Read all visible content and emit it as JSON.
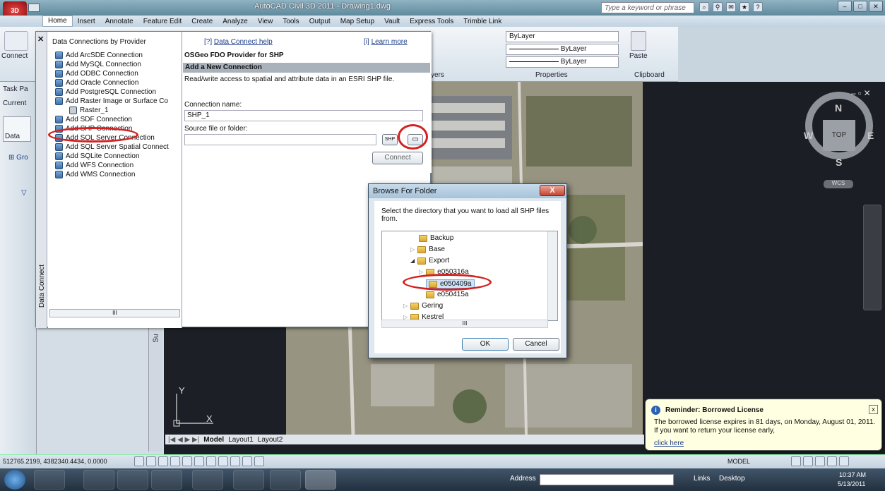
{
  "titlebar": {
    "app_badge": "3D",
    "title": "AutoCAD Civil 3D 2011 - Drawing1.dwg",
    "search_placeholder": "Type a keyword or phrase"
  },
  "menu": [
    "Home",
    "Insert",
    "Annotate",
    "Feature Edit",
    "Create",
    "Analyze",
    "View",
    "Tools",
    "Output",
    "Map Setup",
    "Vault",
    "Express Tools",
    "Trimble Link"
  ],
  "ribbon": {
    "connect_label": "Connect",
    "bylayer_top": "ByLayer",
    "bylayer_mid": "ByLayer",
    "bylayer_low": "ByLayer",
    "layers_label": "yers",
    "properties_label": "Properties",
    "paste_label": "Paste",
    "clipboard_label": "Clipboard"
  },
  "task_pane": {
    "label": "Task Pa",
    "current": "Current",
    "data": "Data",
    "group": "Gro",
    "side_label": "Su"
  },
  "data_connect": {
    "side_label": "Data Connect",
    "list_header": "Data Connections by Provider",
    "help": "Data Connect help",
    "learn_more": "Learn more",
    "items": [
      "Add ArcSDE Connection",
      "Add MySQL Connection",
      "Add ODBC Connection",
      "Add Oracle Connection",
      "Add PostgreSQL Connection",
      "Add Raster Image or Surface Co",
      "Raster_1",
      "Add SDF Connection",
      "Add SHP Connection",
      "Add SQL Server Connection",
      "Add SQL Server Spatial Connect",
      "Add SQLite Connection",
      "Add WFS Connection",
      "Add WMS Connection"
    ],
    "provider_title": "OSGeo FDO Provider for SHP",
    "section_title": "Add a New Connection",
    "description": "Read/write access to spatial and attribute data in an ESRI SHP file.",
    "conn_name_label": "Connection name:",
    "conn_name_value": "SHP_1",
    "source_label": "Source file or folder:",
    "source_value": "",
    "shp_btn": "SHP",
    "connect_btn": "Connect",
    "scroll_marker": "III"
  },
  "browse": {
    "title": "Browse For Folder",
    "close": "X",
    "instruction": "Select the directory that you want to load all SHP files from.",
    "tree": [
      {
        "label": "Backup",
        "indent": 0,
        "arrow": ""
      },
      {
        "label": "Base",
        "indent": 0,
        "arrow": "▷"
      },
      {
        "label": "Export",
        "indent": 0,
        "arrow": "◢"
      },
      {
        "label": "e050316a",
        "indent": 1,
        "arrow": "▷"
      },
      {
        "label": "e050409a",
        "indent": 1,
        "arrow": ""
      },
      {
        "label": "e050415a",
        "indent": 1,
        "arrow": ""
      },
      {
        "label": "Gering",
        "indent": -1,
        "arrow": "▷"
      },
      {
        "label": "Kestrel",
        "indent": -1,
        "arrow": "▷"
      }
    ],
    "ok": "OK",
    "cancel": "Cancel",
    "scroll_marker": "III"
  },
  "viewcube": {
    "n": "N",
    "s": "S",
    "e": "E",
    "w": "W",
    "top": "TOP",
    "wcs": "WCS"
  },
  "drawing": {
    "axis_y": "Y",
    "axis_x": "X",
    "tabs": [
      "Model",
      "Layout1",
      "Layout2"
    ]
  },
  "status": {
    "coords": "512765.2199, 4382340.4434, 0.0000",
    "model": "MODEL"
  },
  "balloon": {
    "title": "Reminder: Borrowed License",
    "text": "The borrowed license expires in 81 days, on Monday, August 01, 2011. If you want to return your license early,",
    "link": "click here",
    "close": "x"
  },
  "taskbar": {
    "address_label": "Address",
    "links": "Links",
    "desktop": "Desktop",
    "time": "10:37 AM",
    "date": "5/13/2011"
  },
  "colors": {
    "highlight_red": "#d32121",
    "accent_blue": "#3d6fa8"
  }
}
